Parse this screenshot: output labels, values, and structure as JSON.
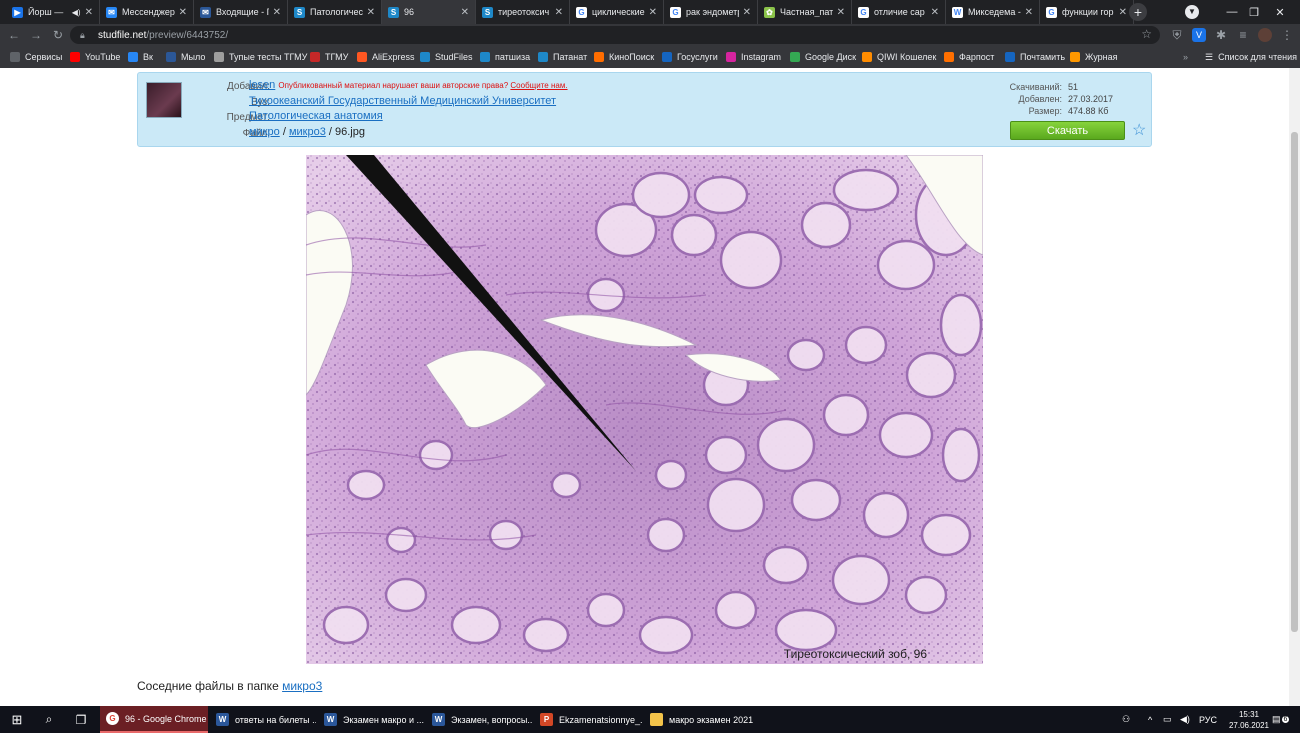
{
  "tabs": [
    {
      "label": "Йорш —",
      "color": "#1a73e8",
      "glyph": "▶",
      "audio": true
    },
    {
      "label": "Мессенджер",
      "color": "#2787f5",
      "glyph": "✉"
    },
    {
      "label": "Входящие - П",
      "color": "#2b5797",
      "glyph": "✉"
    },
    {
      "label": "Патологическ",
      "color": "#1e88c8",
      "glyph": "S"
    },
    {
      "label": "96",
      "color": "#1e88c8",
      "glyph": "S",
      "active": true
    },
    {
      "label": "тиреотоксич",
      "color": "#1e88c8",
      "glyph": "S"
    },
    {
      "label": "циклические",
      "color": "#ffffff",
      "glyph": "G"
    },
    {
      "label": "рак эндометр",
      "color": "#ffffff",
      "glyph": "G"
    },
    {
      "label": "Частная_пат",
      "color": "#8bc34a",
      "glyph": "✿"
    },
    {
      "label": "отличие сар",
      "color": "#ffffff",
      "glyph": "G"
    },
    {
      "label": "Микседема -",
      "color": "#ffffff",
      "glyph": "W"
    },
    {
      "label": "функции гор",
      "color": "#ffffff",
      "glyph": "G"
    }
  ],
  "url": {
    "host": "studfile.net",
    "path": "/preview/6443752/"
  },
  "bookmarks": [
    {
      "label": "Сервисы",
      "color": "#5f6368"
    },
    {
      "label": "YouTube",
      "color": "#ff0000"
    },
    {
      "label": "Вк",
      "color": "#2787f5"
    },
    {
      "label": "Мыло",
      "color": "#2b5797"
    },
    {
      "label": "Тупые тесты ТГМУ",
      "color": "#9e9e9e"
    },
    {
      "label": "ТГМУ",
      "color": "#c62828"
    },
    {
      "label": "AliExpress",
      "color": "#ff5722"
    },
    {
      "label": "StudFiles",
      "color": "#1e88c8"
    },
    {
      "label": "патшиза",
      "color": "#1e88c8"
    },
    {
      "label": "Патанат",
      "color": "#1e88c8"
    },
    {
      "label": "КиноПоиск",
      "color": "#ff6d00"
    },
    {
      "label": "Госуслуги",
      "color": "#1565c0"
    },
    {
      "label": "Instagram",
      "color": "#d6249f"
    },
    {
      "label": "Google Диск",
      "color": "#34a853"
    },
    {
      "label": "QIWI Кошелек",
      "color": "#ff8c00"
    },
    {
      "label": "Фарпост",
      "color": "#ff6f00"
    },
    {
      "label": "Почтамить",
      "color": "#1565c0"
    },
    {
      "label": "Журная",
      "color": "#ff9800"
    }
  ],
  "reading_list": "Список для чтения",
  "file": {
    "labels": {
      "added_by": "Добавил:",
      "university": "Вуз:",
      "subject": "Предмет:",
      "file": "Файл:"
    },
    "author": "lesen",
    "warning_text": "Опубликованный материал нарушает ваши авторские права?",
    "warning_link": "Сообщите нам.",
    "university": "Тихоокеанский Государственный Медицинский Университет",
    "subject": "Патологическая анатомия",
    "path_1": "микро",
    "path_2": "микро3",
    "sep": "/",
    "filename": "96.jpg",
    "stats": {
      "downloads_label": "Скачиваний:",
      "downloads": "51",
      "added_label": "Добавлен:",
      "added": "27.03.2017",
      "size_label": "Размер:",
      "size": "474.88 Кб"
    },
    "download_button": "Скачать"
  },
  "image": {
    "caption": "Тиреотоксический зоб, 96"
  },
  "neighbors": {
    "text": "Соседние файлы в папке",
    "folder": "микро3"
  },
  "taskbar": {
    "apps": [
      {
        "label": "96 - Google Chrome",
        "color": "#ffffff",
        "glyph": "G",
        "active": true
      },
      {
        "label": "ответы на билеты ...",
        "color": "#2b579a",
        "glyph": "W"
      },
      {
        "label": "Экзамен макро и ...",
        "color": "#2b579a",
        "glyph": "W"
      },
      {
        "label": "Экзамен, вопросы...",
        "color": "#2b579a",
        "glyph": "W"
      },
      {
        "label": "Ekzamenatsionnye_...",
        "color": "#d24726",
        "glyph": "P"
      },
      {
        "label": "макро экзамен 2021",
        "color": "#f3c34a",
        "glyph": ""
      }
    ],
    "lang": "РУС",
    "time": "15:31",
    "date": "27.06.2021",
    "notifications": "6"
  }
}
